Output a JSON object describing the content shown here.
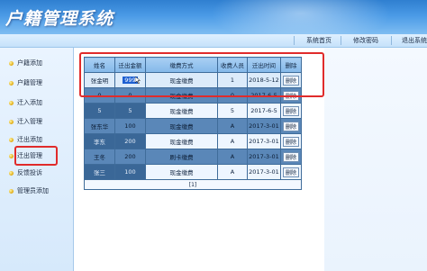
{
  "header": {
    "title": "户籍管理系统"
  },
  "nav": {
    "home": "系统首页",
    "password": "修改密码",
    "logout": "退出系统"
  },
  "sidebar": {
    "items": [
      {
        "label": "户籍添加"
      },
      {
        "label": "户籍管理"
      },
      {
        "label": "迁入添加"
      },
      {
        "label": "迁入管理"
      },
      {
        "label": "迁出添加"
      },
      {
        "label": "迁出管理"
      },
      {
        "label": "反馈投诉"
      },
      {
        "label": "管理员添加"
      }
    ]
  },
  "table": {
    "headers": [
      "姓名",
      "迁出金额",
      "缴费方式",
      "收费人员",
      "迁出时间",
      "删除"
    ],
    "rows": [
      {
        "name": "张金明",
        "amount": "999",
        "method": "现金缴费",
        "staff": "1",
        "date": "2018-5-12",
        "action": "删除"
      },
      {
        "name": "0",
        "amount": "0",
        "method": "现金缴费",
        "staff": "0",
        "date": "2017-6-5",
        "action": "删除"
      },
      {
        "name": "5",
        "amount": "5",
        "method": "现金缴费",
        "staff": "5",
        "date": "2017-6-5",
        "action": "删除"
      },
      {
        "name": "张东华",
        "amount": "100",
        "method": "现金缴费",
        "staff": "A",
        "date": "2017-3-01",
        "action": "删除"
      },
      {
        "name": "李东",
        "amount": "200",
        "method": "现金缴费",
        "staff": "A",
        "date": "2017-3-01",
        "action": "删除"
      },
      {
        "name": "王冬",
        "amount": "200",
        "method": "刷卡缴费",
        "staff": "A",
        "date": "2017-3-01",
        "action": "删除"
      },
      {
        "name": "张三",
        "amount": "100",
        "method": "现金缴费",
        "staff": "A",
        "date": "2017-3-01",
        "action": "删除"
      }
    ],
    "pager": "[1]"
  },
  "colors": {
    "header_blue": "#2f7fd0",
    "highlight_red": "#e02b2b",
    "selection_blue": "#1d5fd1"
  }
}
